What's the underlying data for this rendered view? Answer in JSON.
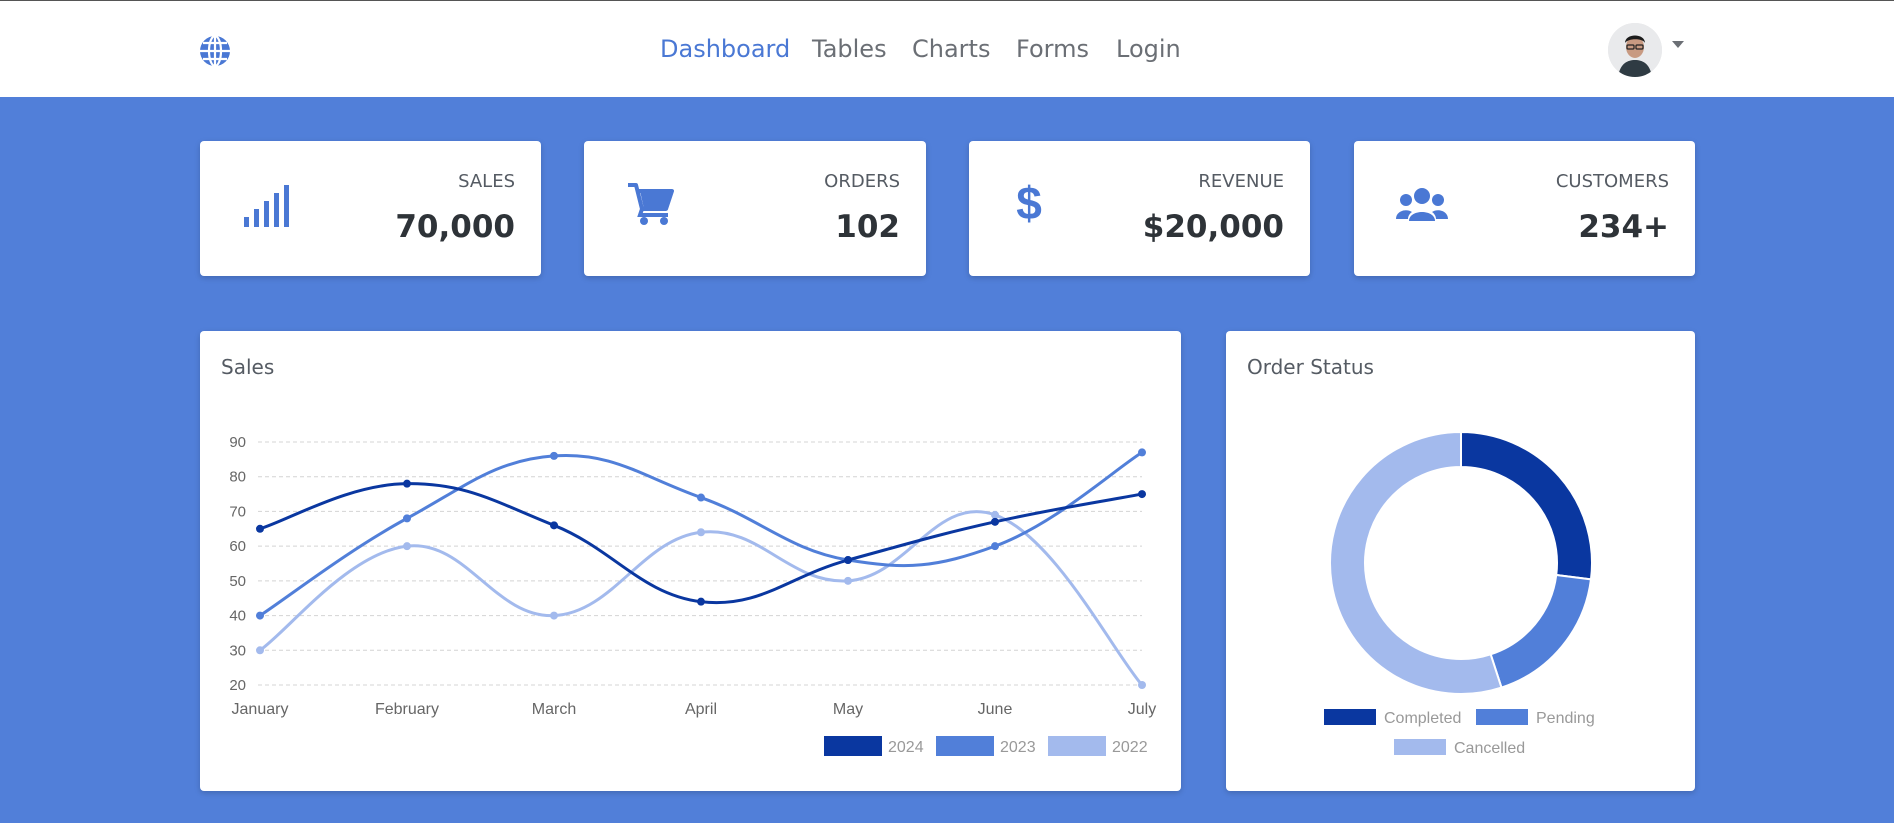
{
  "nav": {
    "items": [
      {
        "label": "Dashboard",
        "active": true
      },
      {
        "label": "Tables",
        "active": false
      },
      {
        "label": "Charts",
        "active": false
      },
      {
        "label": "Forms",
        "active": false
      },
      {
        "label": "Login",
        "active": false
      }
    ]
  },
  "stats": [
    {
      "title": "SALES",
      "value": "70,000",
      "icon": "signal-bars-icon"
    },
    {
      "title": "ORDERS",
      "value": "102",
      "icon": "shopping-cart-icon"
    },
    {
      "title": "REVENUE",
      "value": "$20,000",
      "icon": "dollar-icon"
    },
    {
      "title": "CUSTOMERS",
      "value": "234+",
      "icon": "users-icon"
    }
  ],
  "sales_panel": {
    "title": "Sales"
  },
  "status_panel": {
    "title": "Order Status"
  },
  "colors": {
    "accent": "#517fd9",
    "series_2024": "#0a37a0",
    "series_2023": "#517fd9",
    "series_2022": "#a3baed"
  },
  "chart_data": [
    {
      "type": "line",
      "title": "Sales",
      "categories": [
        "January",
        "February",
        "March",
        "April",
        "May",
        "June",
        "July"
      ],
      "ylim": [
        20,
        90
      ],
      "yticks": [
        20,
        30,
        40,
        50,
        60,
        70,
        80,
        90
      ],
      "grid": true,
      "legend": "bottom-right",
      "series": [
        {
          "name": "2024",
          "values": [
            65,
            78,
            66,
            44,
            56,
            67,
            75
          ]
        },
        {
          "name": "2023",
          "values": [
            40,
            68,
            86,
            74,
            56,
            60,
            87
          ]
        },
        {
          "name": "2022",
          "values": [
            30,
            60,
            40,
            64,
            50,
            69,
            20
          ]
        }
      ]
    },
    {
      "type": "pie",
      "title": "Order Status",
      "legend": "bottom",
      "labels": [
        "Completed",
        "Pending",
        "Cancelled"
      ],
      "values": [
        27,
        18,
        55
      ]
    }
  ]
}
